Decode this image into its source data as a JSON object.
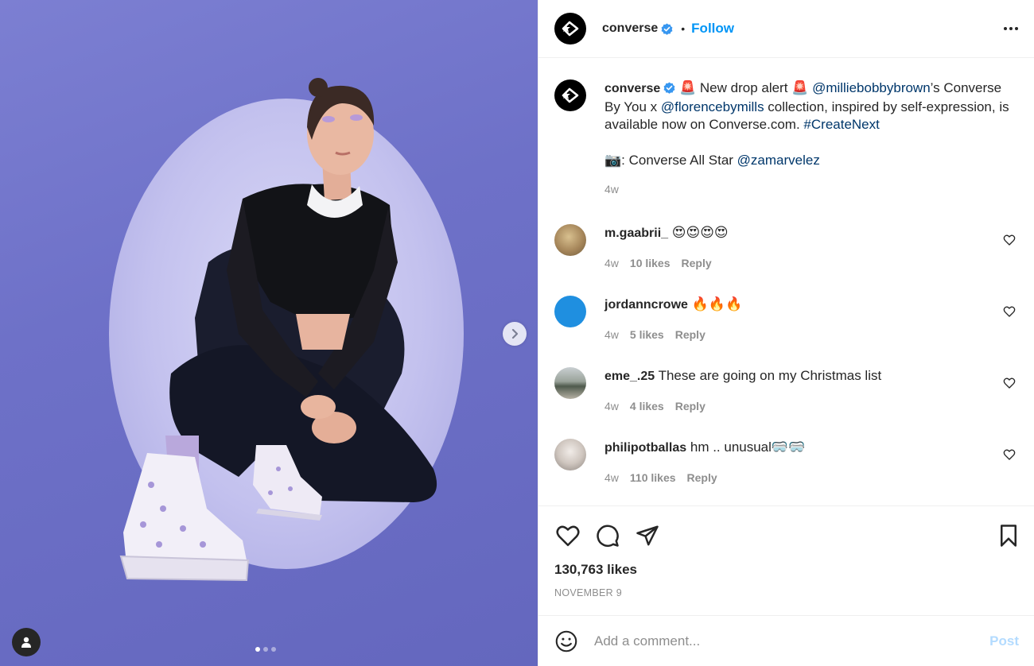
{
  "colors": {
    "accent": "#0095f6",
    "link": "#00376b",
    "muted": "#8e8e8e",
    "text": "#262626",
    "photo_bg": "#6e71c8"
  },
  "header": {
    "username": "converse",
    "follow_label": "Follow",
    "separator": "•"
  },
  "caption": {
    "username": "converse",
    "part1": "🚨 New drop alert 🚨 ",
    "mention1": "@milliebobbybrown",
    "part2": "’s Converse By You x ",
    "mention2": "@florencebymills",
    "part3": " collection, inspired by self-expression, is available now on Converse.com. ",
    "hashtag": "#CreateNext",
    "credit_prefix": "📷: Converse All Star ",
    "credit_mention": "@zamarvelez",
    "time": "4w"
  },
  "comments": [
    {
      "username": "m.gaabrii_",
      "text": "😍😍😍😍",
      "time": "4w",
      "likes": "10 likes",
      "reply": "Reply",
      "avatar_color": "#b59a6e"
    },
    {
      "username": "jordanncrowe",
      "text": "🔥🔥🔥",
      "time": "4w",
      "likes": "5 likes",
      "reply": "Reply",
      "avatar_color": "#1f8fe0"
    },
    {
      "username": "eme_.25",
      "text": "These are going on my Christmas list",
      "time": "4w",
      "likes": "4 likes",
      "reply": "Reply",
      "avatar_color": "#8a8f86"
    },
    {
      "username": "philipotballas",
      "text": "hm .. unusual🥽🥽",
      "time": "4w",
      "likes": "110 likes",
      "reply": "Reply",
      "avatar_color": "#cfc8c2"
    }
  ],
  "actions": {
    "likes": "130,763 likes",
    "date": "NOVEMBER 9"
  },
  "comment_box": {
    "placeholder": "Add a comment...",
    "post_label": "Post"
  },
  "icons": {
    "logo": "converse-logo-icon",
    "verified": "verified-badge-icon",
    "more": "more-options-icon",
    "next": "chevron-right-icon",
    "tagged": "user-tag-icon",
    "heart": "heart-icon",
    "comment": "comment-icon",
    "share": "paper-plane-icon",
    "save": "bookmark-icon",
    "emoji": "smiley-icon"
  },
  "carousel": {
    "count": 3,
    "active": 1
  }
}
